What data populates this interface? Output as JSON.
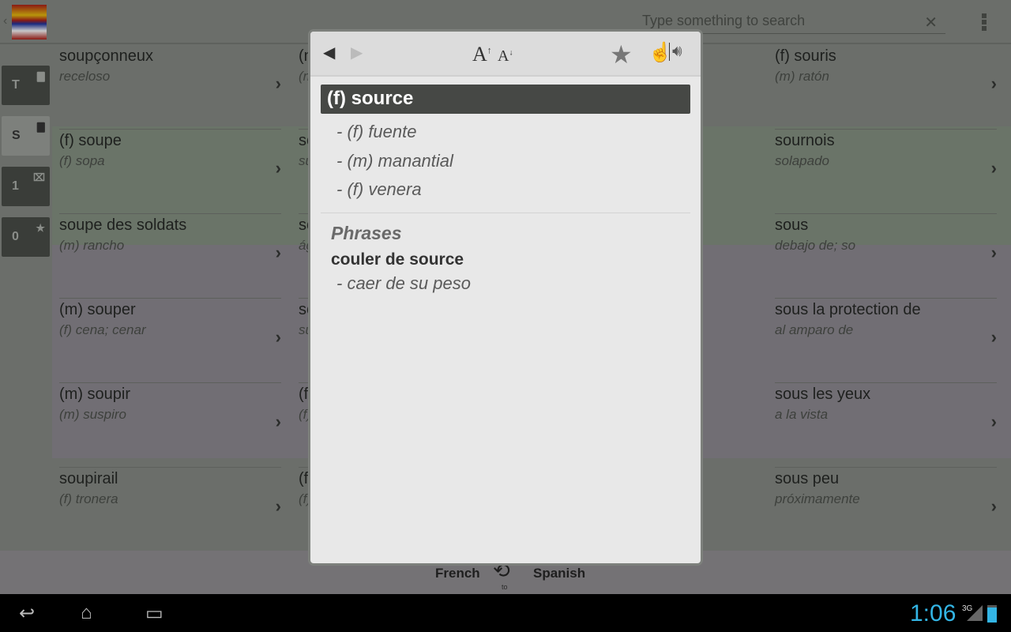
{
  "header": {
    "back_icon": "chevron-left-icon",
    "search_placeholder": "Type something to search",
    "clear_icon": "close-icon",
    "menu_icon": "overflow-menu-icon"
  },
  "sidebar": {
    "tabs": [
      {
        "label": "T",
        "icon": "spanish-flag-icon",
        "selected": false
      },
      {
        "label": "S",
        "icon": "french-flag-icon",
        "selected": true
      },
      {
        "label": "1",
        "icon": "history-icon",
        "selected": false
      },
      {
        "label": "0",
        "icon": "star-icon",
        "selected": false
      }
    ]
  },
  "list": {
    "col1": [
      {
        "term": "soupçonneux",
        "translation": "receloso"
      },
      {
        "term": "(f) soupe",
        "translation": "(f) sopa"
      },
      {
        "term": "soupe des soldats",
        "translation": "(m) rancho"
      },
      {
        "term": "(m) souper",
        "translation": "(f) cena; cenar"
      },
      {
        "term": "(m) soupir",
        "translation": "(m) suspiro"
      },
      {
        "term": "soupirail",
        "translation": "(f) tronera"
      }
    ],
    "col2": [
      {
        "term": "(m",
        "translation": "(m"
      },
      {
        "term": "so",
        "translation": "su"
      },
      {
        "term": "so",
        "translation": "ág"
      },
      {
        "term": "so",
        "translation": "su"
      },
      {
        "term": "(f)",
        "translation": "(f)"
      },
      {
        "term": "(f)",
        "translation": "(f)"
      }
    ],
    "col4": [
      {
        "term": "(f) souris",
        "translation": "(m) ratón"
      },
      {
        "term": "sournois",
        "translation": "solapado"
      },
      {
        "term": "sous",
        "translation": "debajo de; so"
      },
      {
        "term": "sous la protection de",
        "translation": "al amparo de"
      },
      {
        "term": "sous les yeux",
        "translation": "a la vista"
      },
      {
        "term": "sous peu",
        "translation": "próximamente"
      }
    ]
  },
  "popup": {
    "headword": "(f) source",
    "translations": [
      "- (f) fuente",
      "- (m) manantial",
      "- (f) venera"
    ],
    "phrases_label": "Phrases",
    "phrases": [
      {
        "phrase": "couler de source",
        "translation": "- caer de su peso"
      }
    ]
  },
  "bottom": {
    "from": "French",
    "to_label": "to",
    "to": "Spanish"
  },
  "status": {
    "time": "1:06",
    "network": "3G"
  }
}
